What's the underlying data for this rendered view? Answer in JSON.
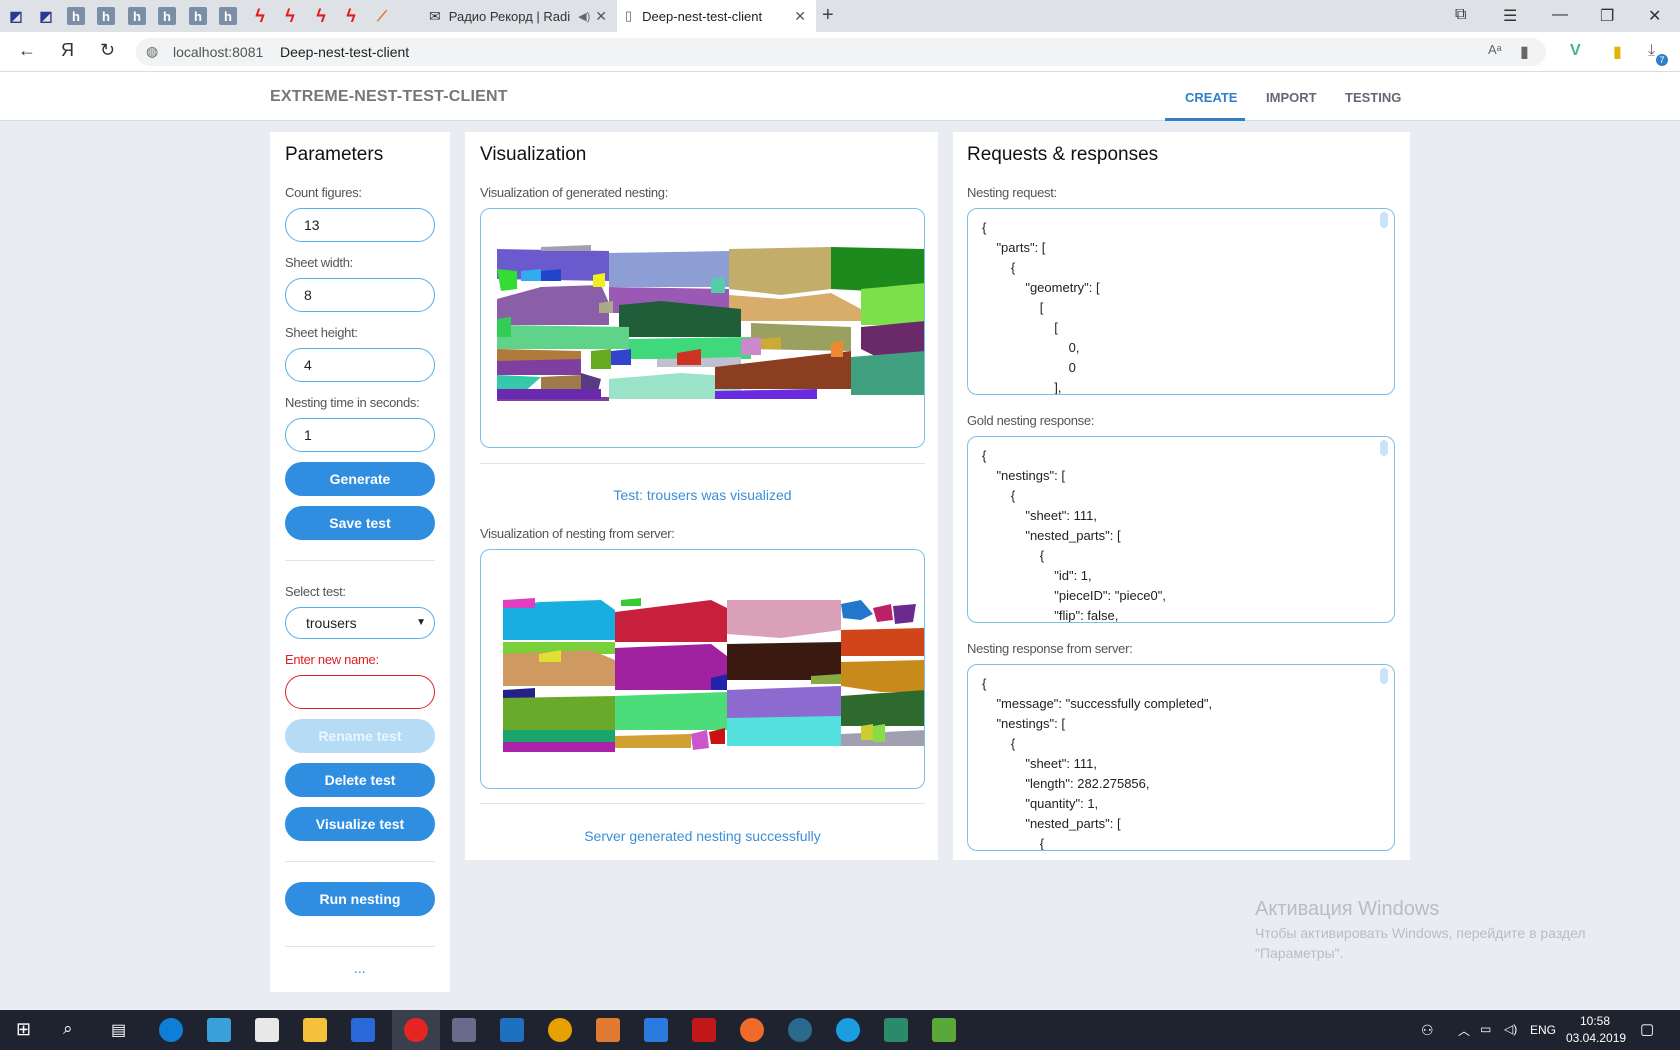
{
  "browser": {
    "tabs": [
      {
        "label": "Радио Рекорд | Radi"
      },
      {
        "label": "Deep-nest-test-client"
      }
    ],
    "url_host": "localhost:8081",
    "url_title": "Deep-nest-test-client",
    "yandex_letter": "Я"
  },
  "header": {
    "title": "EXTREME-NEST-TEST-CLIENT",
    "tabs": [
      "CREATE",
      "IMPORT",
      "TESTING"
    ],
    "active_tab": "CREATE"
  },
  "parameters": {
    "heading": "Parameters",
    "count_label": "Count figures:",
    "count_value": "13",
    "width_label": "Sheet width:",
    "width_value": "8",
    "height_label": "Sheet height:",
    "height_value": "4",
    "time_label": "Nesting time in seconds:",
    "time_value": "1",
    "generate": "Generate",
    "save": "Save test",
    "select_label": "Select test:",
    "select_value": "trousers",
    "new_name_label": "Enter new name:",
    "new_name_value": "",
    "rename": "Rename test",
    "delete": "Delete test",
    "visualize": "Visualize test",
    "run": "Run nesting",
    "more": "..."
  },
  "visualization": {
    "heading": "Visualization",
    "generated_label": "Visualization of generated nesting:",
    "generated_status": "Test: trousers was visualized",
    "server_label": "Visualization of nesting from server:",
    "server_status": "Server generated nesting successfully"
  },
  "requests": {
    "heading": "Requests & responses",
    "request_label": "Nesting request:",
    "request_json": "{\n    \"parts\": [\n        {\n            \"geometry\": [\n                [\n                    [\n                        0,\n                        0\n                    ],",
    "gold_label": "Gold nesting response:",
    "gold_json": "{\n    \"nestings\": [\n        {\n            \"sheet\": 111,\n            \"nested_parts\": [\n                {\n                    \"id\": 1,\n                    \"pieceID\": \"piece0\",\n                    \"flip\": false,",
    "server_label": "Nesting response from server:",
    "server_json": "{\n    \"message\": \"successfully completed\",\n    \"nestings\": [\n        {\n            \"sheet\": 111,\n            \"length\": 282.275856,\n            \"quantity\": 1,\n            \"nested_parts\": [\n                {"
  },
  "watermark": {
    "title": "Активация Windows",
    "text": "Чтобы активировать Windows, перейдите в раздел \"Параметры\"."
  },
  "taskbar": {
    "lang": "ENG",
    "time": "10:58",
    "date": "03.04.2019",
    "download_badge": "7"
  },
  "colors": {
    "accent": "#2f80c9",
    "button": "#2f8ee0",
    "error": "#e02020"
  }
}
